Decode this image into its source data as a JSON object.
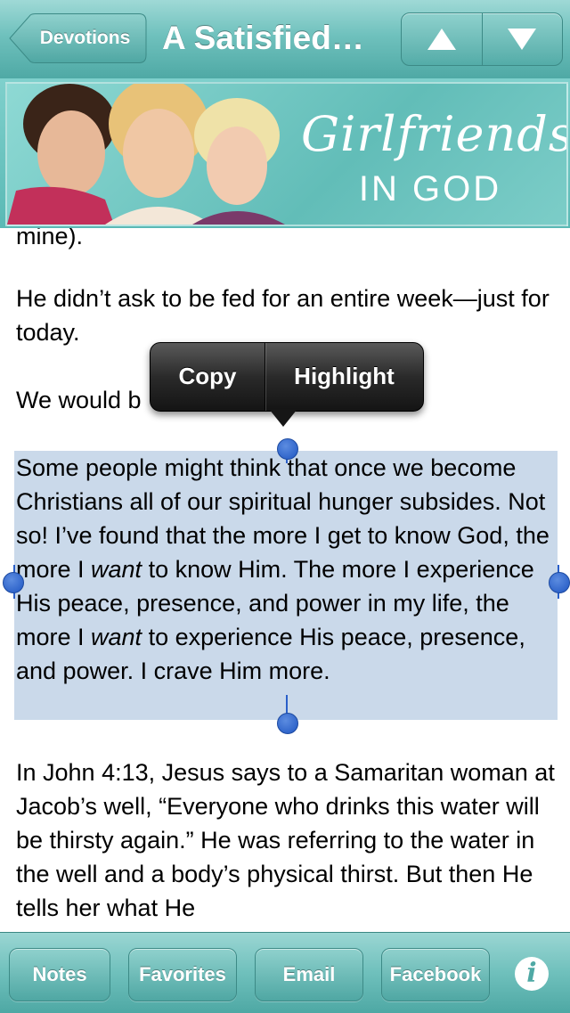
{
  "nav": {
    "back_label": "Devotions",
    "title": "A Satisfied…",
    "prev_icon": "up-triangle-icon",
    "next_icon": "down-triangle-icon"
  },
  "banner": {
    "logo_line1": "Girlfriends",
    "logo_line2": "IN GOD"
  },
  "content": {
    "cut_off_text": "mine).",
    "para1": "He didn’t ask to be fed for an entire week—just for today.",
    "para2_visible": "We would b",
    "para2_tail": ".",
    "selected_paragraph": [
      {
        "text": "Some people might think that once we become Christians all of our spiritual hunger subsides. Not so! I’ve found that the more I get to know God, the more I ",
        "italic": false
      },
      {
        "text": "want",
        "italic": true
      },
      {
        "text": " to know Him. The more I experience His peace, presence, and power in my life, the more I ",
        "italic": false
      },
      {
        "text": "want",
        "italic": true
      },
      {
        "text": " to experience His peace, presence, and power. I crave Him more.",
        "italic": false
      }
    ],
    "para4": "In John 4:13, Jesus says to a Samaritan woman at Jacob’s well, “Everyone who drinks this water will be thirsty again.” He was referring to the water in the well and a body’s physical thirst. But then He tells her what He"
  },
  "callout": {
    "copy_label": "Copy",
    "highlight_label": "Highlight"
  },
  "toolbar": {
    "notes_label": "Notes",
    "favorites_label": "Favorites",
    "email_label": "Email",
    "facebook_label": "Facebook",
    "info_icon": "info-icon",
    "info_glyph": "i"
  },
  "colors": {
    "teal_bar": "#6fc1bd",
    "selection": "#cad9ea",
    "handle": "#1f56c2"
  }
}
